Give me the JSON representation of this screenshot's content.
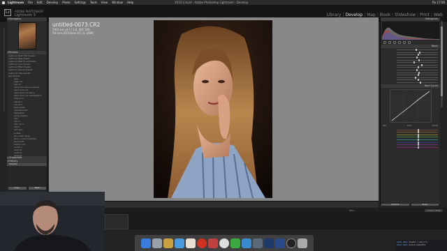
{
  "menubar": {
    "app": "Lightroom",
    "items": [
      "File",
      "Edit",
      "Develop",
      "Photo",
      "Settings",
      "Tools",
      "View",
      "Window",
      "Help"
    ],
    "window_title": "2015-1.lrcat - Adobe Photoshop Lightroom - Develop",
    "clock": "Пн 17:56"
  },
  "identity": {
    "logo": "Lr",
    "line1": "ADOBE PHOTOSHOP",
    "line2": "Lightroom 5"
  },
  "modules": [
    {
      "label": "Library",
      "active": false
    },
    {
      "label": "Develop",
      "active": true
    },
    {
      "label": "Map",
      "active": false
    },
    {
      "label": "Book",
      "active": false
    },
    {
      "label": "Slideshow",
      "active": false
    },
    {
      "label": "Print",
      "active": false
    },
    {
      "label": "Web",
      "active": false
    }
  ],
  "left_panel": {
    "navigator_title": "Navigator",
    "presets_title": "Presets",
    "presets": [
      {
        "label": "Lightroom B&W Filter Presets",
        "sub": false,
        "hl": false
      },
      {
        "label": "Lightroom B&W Presets",
        "sub": false,
        "hl": false
      },
      {
        "label": "Lightroom B&W Toned Presets",
        "sub": false,
        "hl": false
      },
      {
        "label": "Lightroom Color Presets",
        "sub": false,
        "hl": false
      },
      {
        "label": "Lightroom Effect Presets",
        "sub": false,
        "hl": false
      },
      {
        "label": "Lightroom General Presets",
        "sub": false,
        "hl": false
      },
      {
        "label": "Lightroom Video Presets",
        "sub": false,
        "hl": false
      },
      {
        "label": "User Presets",
        "sub": false,
        "hl": false
      },
      {
        "label": "jpeg",
        "sub": true,
        "hl": false
      },
      {
        "label": "sagai 1Ak",
        "sub": true,
        "hl": false
      },
      {
        "label": "Alex 44",
        "sub": true,
        "hl": false
      },
      {
        "label": "Alexandra drabove contrast",
        "sub": true,
        "hl": false
      },
      {
        "label": "Clean Grain 2.0",
        "sub": true,
        "hl": false
      },
      {
        "label": "Clean Grain 2.0 sesmy",
        "sub": true,
        "hl": false
      },
      {
        "label": "Clean Grain 2.0 vsesmjadnych",
        "sub": true,
        "hl": false
      },
      {
        "label": "CriglnCold",
        "sub": true,
        "hl": false
      },
      {
        "label": "inquisit 1",
        "sub": true,
        "hl": false
      },
      {
        "label": "inquisit 2",
        "sub": true,
        "hl": false
      },
      {
        "label": "fashionwash",
        "sub": true,
        "hl": false
      },
      {
        "label": "highlight-blue2",
        "sub": true,
        "hl": false
      },
      {
        "label": "highlights0",
        "sub": true,
        "hl": false
      },
      {
        "label": "poppy sharpen",
        "sub": true,
        "hl": false
      },
      {
        "label": "retro",
        "sub": true,
        "hl": false
      },
      {
        "label": "retro-2",
        "sub": true,
        "hl": false
      },
      {
        "label": "retro de vf",
        "sub": true,
        "hl": false
      },
      {
        "label": "retro3",
        "sub": true,
        "hl": false
      },
      {
        "label": "Soft Calm",
        "sub": true,
        "hl": false
      },
      {
        "label": "sv-fade",
        "sub": true,
        "hl": false
      },
      {
        "label": "stiny wiam happy",
        "sub": true,
        "hl": false
      },
      {
        "label": "stiny + colors matchless",
        "sub": true,
        "hl": false
      },
      {
        "label": "Sunset soft",
        "sub": true,
        "hl": false
      },
      {
        "label": "vedorie cont",
        "sub": true,
        "hl": false
      },
      {
        "label": "vedorie s",
        "sub": true,
        "hl": false
      },
      {
        "label": "vedorie1",
        "sub": true,
        "hl": false
      },
      {
        "label": "vedorie2",
        "sub": true,
        "hl": false
      },
      {
        "label": "vedorie3",
        "sub": true,
        "hl": false
      },
      {
        "label": "User Presets",
        "sub": false,
        "hl": false
      }
    ],
    "snapshots_title": "Snapshots",
    "history_title": "History",
    "history_item": "Template",
    "copy_label": "Copy...",
    "paste_label": "Paste"
  },
  "image_info": {
    "filename": "untitled-0073.CR2",
    "line1": "1/60 sec at f / 2.0, ISO 100",
    "line2": "50 mm (EF50mm f/1.2L USM)"
  },
  "right_panel": {
    "histogram_title": "Histogram",
    "basic_title": "Basic",
    "tone_curve_title": "Tone Curve",
    "hsl_tabs": [
      "HSL",
      "Color",
      "B & W"
    ],
    "previous_label": "Previous",
    "reset_label": "Reset"
  },
  "filmstrip": {
    "filter_label": "Filter:",
    "custom_filter": "Custom Filter"
  },
  "chat": {
    "lines": [
      {
        "user": "echo_alex:",
        "text": "привет с чем сто"
      },
      {
        "user": "echo_alex:",
        "text": "нежно давайте"
      }
    ]
  },
  "accent": "#e6e6e6",
  "center_bg": "#888888"
}
